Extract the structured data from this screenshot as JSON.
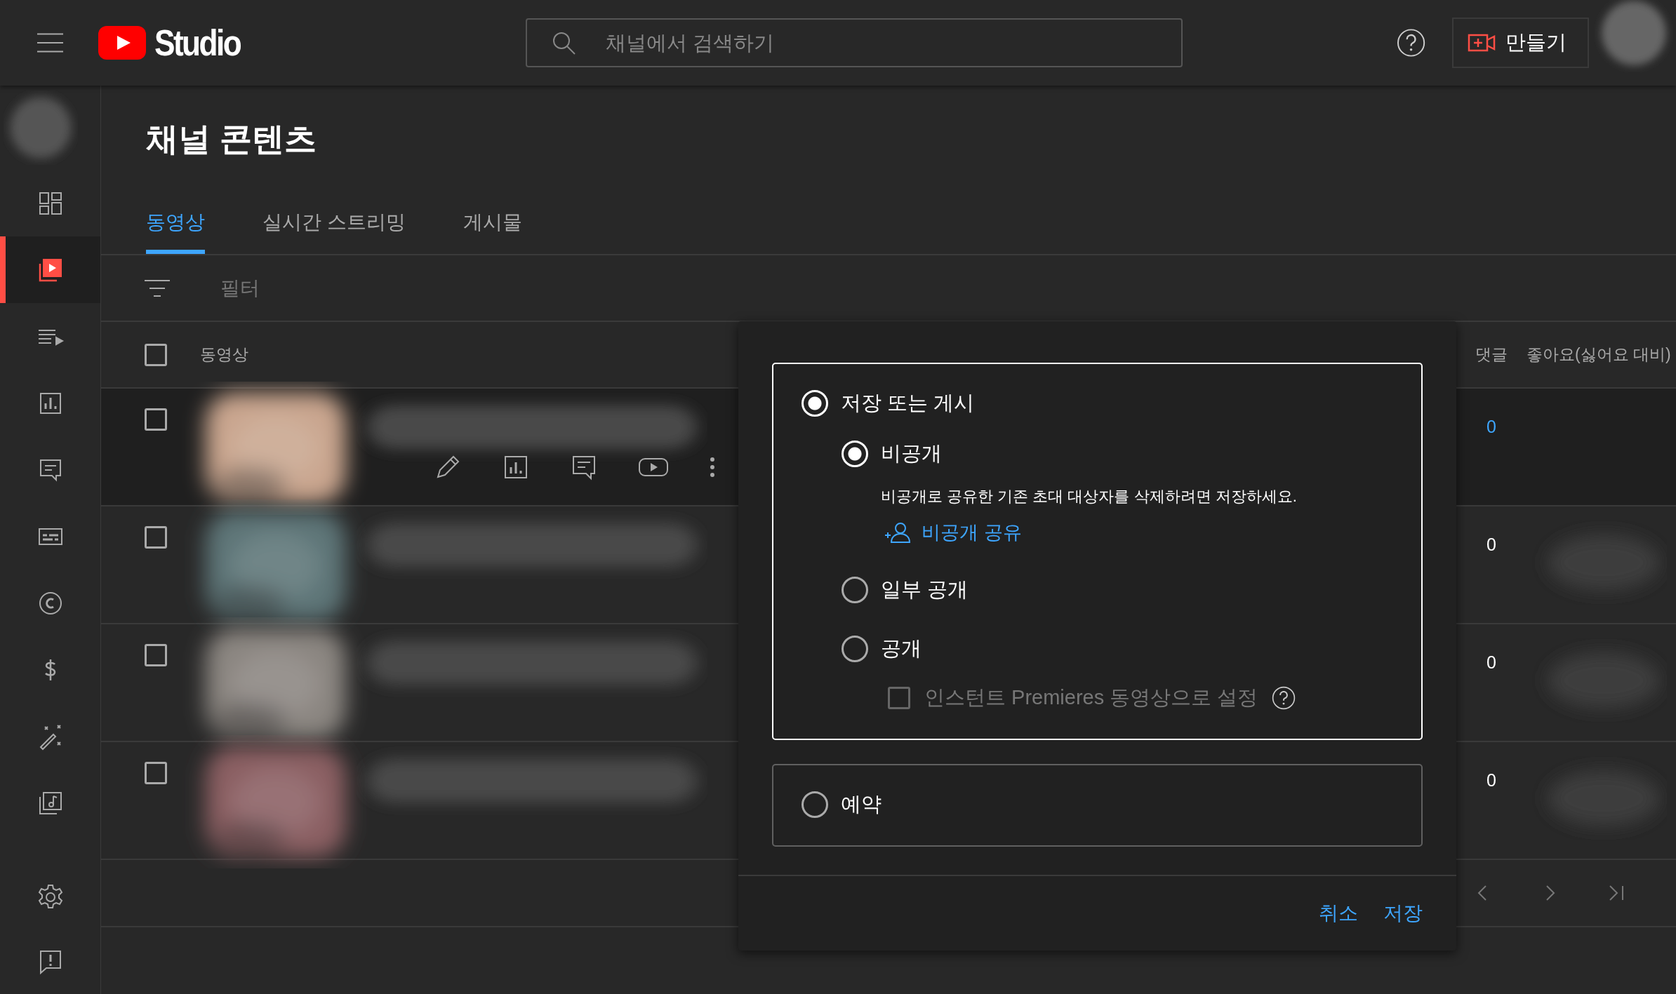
{
  "header": {
    "app_name": "Studio",
    "search": {
      "placeholder": "채널에서 검색하기"
    },
    "create_button": "만들기"
  },
  "sidebar": {
    "items": [
      {
        "kind": "dashboard",
        "selected": false
      },
      {
        "kind": "content",
        "selected": true
      },
      {
        "kind": "playlists",
        "selected": false
      },
      {
        "kind": "analytics",
        "selected": false
      },
      {
        "kind": "comments",
        "selected": false
      },
      {
        "kind": "subtitles",
        "selected": false
      },
      {
        "kind": "copyright",
        "selected": false
      },
      {
        "kind": "earn",
        "selected": false
      },
      {
        "kind": "customize",
        "selected": false
      },
      {
        "kind": "audio",
        "selected": false
      }
    ],
    "bottom_items": [
      {
        "kind": "settings",
        "selected": false
      },
      {
        "kind": "feedback",
        "selected": false
      }
    ]
  },
  "page_title": "채널 콘텐츠",
  "tabs": [
    {
      "label": "동영상",
      "selected": true
    },
    {
      "label": "실시간 스트리밍",
      "selected": false
    },
    {
      "label": "게시물",
      "selected": false
    }
  ],
  "filter": {
    "placeholder": "필터"
  },
  "table": {
    "columns": [
      "동영상",
      "댓글",
      "좋아요(싫어요 대비)"
    ],
    "header_checked": false,
    "rows": [
      {
        "checked": false,
        "hovered": true,
        "comments": "0"
      },
      {
        "checked": false,
        "hovered": false,
        "comments": "0"
      },
      {
        "checked": false,
        "hovered": false,
        "comments": "0"
      },
      {
        "checked": false,
        "hovered": false,
        "comments": "0"
      }
    ]
  },
  "dialog": {
    "groups": [
      {
        "label": "저장 또는 게시",
        "selected": true,
        "options": [
          {
            "label": "비공개",
            "selected": true,
            "note": "비공개로 공유한 기존 초대 대상자를 삭제하려면 저장하세요.",
            "link": "비공개 공유"
          },
          {
            "label": "일부 공개",
            "selected": false
          },
          {
            "label": "공개",
            "selected": false,
            "premiere": {
              "label": "인스턴트 Premieres 동영상으로 설정",
              "checked": false,
              "disabled": true
            }
          }
        ]
      },
      {
        "label": "예약",
        "selected": false
      }
    ],
    "buttons": [
      "취소",
      "저장"
    ]
  }
}
